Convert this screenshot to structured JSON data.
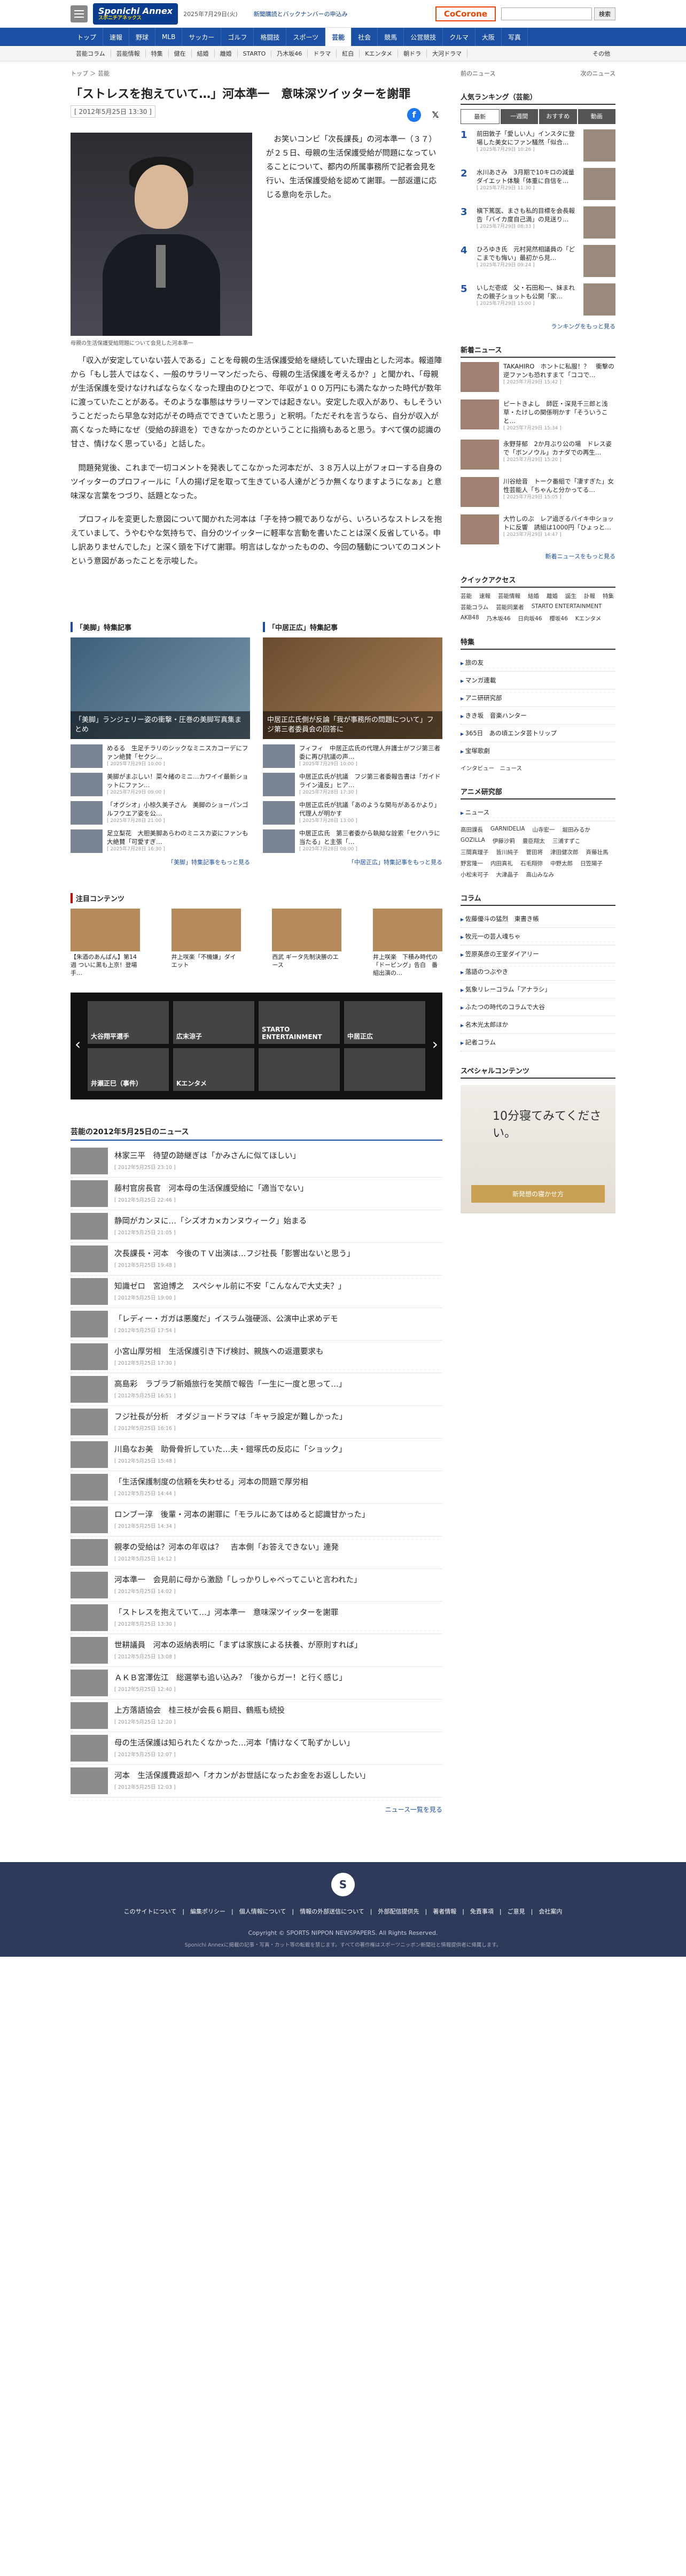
{
  "header": {
    "logo_text": "Sponichi Annex",
    "logo_sub": "スポニチアネックス",
    "date": "2025年7月29日(火)",
    "links": "新聞購読とバックナンバーの申込み",
    "cocorone": "CoCorone",
    "search_placeholder": "",
    "search_button": "検索"
  },
  "nav1": [
    "トップ",
    "速報",
    "野球",
    "MLB",
    "サッカー",
    "ゴルフ",
    "格闘技",
    "スポーツ",
    "芸能",
    "社会",
    "競馬",
    "公営競技",
    "クルマ",
    "大阪",
    "写真"
  ],
  "nav2": [
    "芸能コラム",
    "芸能情報",
    "特集",
    "健在",
    "結婚",
    "離婚",
    "STARTO",
    "乃木坂46",
    "ドラマ",
    "紅白",
    "Kエンタメ",
    "朝ドラ",
    "大河ドラマ"
  ],
  "nav2_more": "その他",
  "breadcrumb": "トップ ＞ 芸能",
  "article": {
    "title": "「ストレスを抱えていて…」河本準一　意味深ツイッターを謝罪",
    "date": "[ 2012年5月25日 13:30 ]",
    "caption": "母親の生活保護受給問題について会見した河本準一",
    "p1": "お笑いコンビ「次長課長」の河本準一（３７）が２５日、母親の生活保護受給が問題になっていることについて、都内の所属事務所で記者会見を行い、生活保護受給を認めて謝罪。一部返還に応じる意向を示した。",
    "p2": "「収入が安定していない芸人である」ことを母親の生活保護受給を継続していた理由とした河本。報道陣から「もし芸人ではなく、一般のサラリーマンだったら、母親の生活保護を考えるか？」と聞かれ、「母親が生活保護を受けなければならなくなった理由のひとつで、年収が１００万円にも満たなかった時代が数年に渡っていたことがある。そのような事態はサラリーマンでは起きない。安定した収入があり、もしそういうことだったら早急な対応がその時点でできていたと思う」と釈明。「ただそれを言うなら、自分が収入が高くなった時になぜ（受給の辞退を）できなかったのかということに指摘もあると思う。すべて僕の認識の甘さ、情けなく思っている」と話した。",
    "p3": "問題発覚後、これまで一切コメントを発表してこなかった河本だが、３８万人以上がフォローする自身のツイッターのプロフィールに「人の揚げ足を取って生きている人達がどうか無くなりますようになぁ」と意味深な言葉をつづり、話題となった。",
    "p4": "プロフィルを変更した意図について聞かれた河本は「子を持つ親でありながら、いろいろなストレスを抱えていまして、うやむやな気持ちで、自分のツイッターに軽率な言動を書いたことは深く反省している。申し訳ありませんでした」と深く頭を下げて謝罪。明言はしなかったものの、今回の騒動についてのコメントという意図があったことを示唆した。",
    "fb": "f",
    "x": "𝕏"
  },
  "special": [
    {
      "head": "「美脚」特集記事",
      "main": "「美脚」ランジェリー姿の衝撃・圧巻の美脚写真集まとめ",
      "items": [
        {
          "t": "めるる　生足チラリのシックなミニスカコーデにファン絶賛「セクシ…",
          "d": "[ 2025年7月29日 10:00 ]"
        },
        {
          "t": "美脚がまぶしい！菜々緒のミニ…カワイイ最新ショットにファン…",
          "d": "[ 2025年7月29日 09:00 ]"
        },
        {
          "t": "「オグシオ」小椋久美子さん　美脚のショーパンゴルフウエア姿を公…",
          "d": "[ 2025年7月28日 21:00 ]"
        },
        {
          "t": "足立梨花　大胆美脚あらわのミニスカ姿にファンも大絶賛「可愛すぎ…",
          "d": "[ 2025年7月28日 16:30 ]"
        }
      ],
      "more": "「美脚」特集記事をもっと見る"
    },
    {
      "head": "「中居正広」特集記事",
      "main": "中居正広氏側が反論「我が事務所の問題について」フジ第三者委員会の回答に",
      "items": [
        {
          "t": "フィフィ　中居正広氏の代理人弁護士がフジ第三者委に再び抗議の声…",
          "d": "[ 2025年7月29日 10:00 ]"
        },
        {
          "t": "中居正広氏が抗議　フジ第三者委報告書は「ガイドライン違反」ヒア…",
          "d": "[ 2025年7月28日 17:30 ]"
        },
        {
          "t": "中居正広氏が抗議「あのような関与があるかより」代理人が明かす",
          "d": "[ 2025年7月28日 13:00 ]"
        },
        {
          "t": "中居正広氏　第三者委から執拗な詮索「セクハラに当たる」と主張「…",
          "d": "[ 2025年7月28日 08:00 ]"
        }
      ],
      "more": "「中居正広」特集記事をもっと見る"
    }
  ],
  "attention": {
    "head": "注目コンテンツ",
    "cards": [
      {
        "t": "【朱酒のあんぱん】第14週 ついに黒も上京！登場手…"
      },
      {
        "t": "井上咲楽「不機嫌」ダイエット"
      },
      {
        "t": "西武 ギータ先制決勝のエース"
      },
      {
        "t": "井上咲楽　下積み時代の「ドーピング」告白　番組出演の…"
      }
    ],
    "sponsored": "Sponsored by"
  },
  "carousel": [
    "大谷翔平選手",
    "広末涼子",
    "STARTO ENTERTAINMENT",
    "中居正広",
    "井瀬正巳（事件）",
    "Kエンタメ",
    "",
    ""
  ],
  "newslist": {
    "head": "芸能の2012年5月25日のニュース",
    "items": [
      {
        "t": "林家三平　待望の跡継ぎは「かみさんに似てほしい」",
        "d": "[ 2012年5月25日 23:10 ]"
      },
      {
        "t": "藤村官房長官　河本母の生活保護受給に「適当でない」",
        "d": "[ 2012年5月25日 22:46 ]"
      },
      {
        "t": "静岡がカンヌに…「シズオカ×カンヌウィーク」始まる",
        "d": "[ 2012年5月25日 21:05 ]"
      },
      {
        "t": "次長課長・河本　今後のＴＶ出演は…フジ社長「影響出ないと思う」",
        "d": "[ 2012年5月25日 19:48 ]"
      },
      {
        "t": "知識ゼロ　宮迫博之　スペシャル前に不安「こんなんで大丈夫？」",
        "d": "[ 2012年5月25日 19:00 ]"
      },
      {
        "t": "「レディー・ガガは悪魔だ」イスラム強硬派、公演中止求めデモ",
        "d": "[ 2012年5月25日 17:54 ]"
      },
      {
        "t": "小宮山厚労相　生活保護引き下げ検討、親族への返還要求も",
        "d": "[ 2012年5月25日 17:30 ]"
      },
      {
        "t": "高島彩　ラブラブ新婚旅行を笑顔で報告「一生に一度と思って…」",
        "d": "[ 2012年5月25日 16:51 ]"
      },
      {
        "t": "フジ社長が分析　オダジョードラマは「キャラ設定が難しかった」",
        "d": "[ 2012年5月25日 16:16 ]"
      },
      {
        "t": "川島なお美　助骨骨折していた…夫・鎧塚氏の反応に「ショック」",
        "d": "[ 2012年5月25日 15:48 ]"
      },
      {
        "t": "「生活保護制度の信頼を失わせる」河本の問題で厚労相",
        "d": "[ 2012年5月25日 14:44 ]"
      },
      {
        "t": "ロンブー淳　後輩・河本の謝罪に「モラルにあてはめると認識甘かった」",
        "d": "[ 2012年5月25日 14:34 ]"
      },
      {
        "t": "親孝の受給は？河本の年収は？　吉本側「お答えできない」連発",
        "d": "[ 2012年5月25日 14:12 ]"
      },
      {
        "t": "河本準一　会見前に母から激励「しっかりしゃべってこいと言われた」",
        "d": "[ 2012年5月25日 14:02 ]"
      },
      {
        "t": "「ストレスを抱えていて…」河本準一　意味深ツイッターを謝罪",
        "d": "[ 2012年5月25日 13:30 ]"
      },
      {
        "t": "世耕議員　河本の返納表明に「まずは家族による扶養、が原則すれば」",
        "d": "[ 2012年5月25日 13:08 ]"
      },
      {
        "t": "ＡＫＢ宮澤佐江　総選挙も追い込み？「後からガー！と行く感じ」",
        "d": "[ 2012年5月25日 12:40 ]"
      },
      {
        "t": "上方落語協会　桂三枝が会長６期目、鶴瓶も続投",
        "d": "[ 2012年5月25日 12:20 ]"
      },
      {
        "t": "母の生活保護は知られたくなかった…河本「情けなくて恥ずかしい」",
        "d": "[ 2012年5月25日 12:07 ]"
      },
      {
        "t": "河本　生活保護費返却へ「オカンがお世話になったお金をお返ししたい」",
        "d": "[ 2012年5月25日 12:03 ]"
      }
    ],
    "more": "ニュース一覧を見る"
  },
  "sidebar": {
    "prev": "前のニュース",
    "next": "次のニュース",
    "rank_head": "人気ランキング（芸能）",
    "rank_tabs": [
      "最新",
      "一週間",
      "おすすめ",
      "動画"
    ],
    "rank": [
      {
        "t": "前田敦子「愛しい人」インスタに登場した美女にファン騒然「似合…",
        "d": "[ 2025年7月29日 10:26 ]"
      },
      {
        "t": "水川あさみ　3月期で10キロの減量ダイエット体験「体重に自信を…",
        "d": "[ 2025年7月29日 11:30 ]"
      },
      {
        "t": "槇下篤医、まさも私的目標を会長報告「バイカ度自己満」の見送り…",
        "d": "[ 2025年7月29日 08:33 ]"
      },
      {
        "t": "ひろゆき氏　元村晃然相議員の「どこまでも悔い」最初から見…",
        "d": "[ 2025年7月29日 09:24 ]"
      },
      {
        "t": "いしだ壱成　父・石田和一、妹まれたの親子ショットも公開「家…",
        "d": "[ 2025年7月29日 15:00 ]"
      }
    ],
    "rank_more": "ランキングをもっと見る",
    "news_head": "新着ニュース",
    "news": [
      {
        "t": "TAKAHIRO　ホントに私服！？　衝撃の逆ファンも恐れすまて「ココで…",
        "d": "[ 2025年7月29日 15:42 ]"
      },
      {
        "t": "ピートきよし　師匠・深見千三郎と浅草・たけしの関係明かす「そういうこと…",
        "d": "[ 2025年7月29日 15:34 ]"
      },
      {
        "t": "永野芽郁　2か月ぶり公の場　ドレス姿で「ボンノウル」カナダでの再生…",
        "d": "[ 2025年7月29日 15:20 ]"
      },
      {
        "t": "川谷絵音　トーク番組で「凄すぎた」女性芸能人「ちゃんと分かってる…",
        "d": "[ 2025年7月29日 15:05 ]"
      },
      {
        "t": "大竹しのぶ　レア過ぎるバイキ中ショットに反響　誘組は1000円「ひょっと…",
        "d": "[ 2025年7月29日 14:47 ]"
      }
    ],
    "news_more": "新着ニュースをもっと見る",
    "quick_head": "クイックアクセス",
    "quick": [
      "芸能",
      "速報",
      "芸能情報",
      "結婚",
      "離婚",
      "誕生",
      "訃報",
      "特集",
      "芸能コラム",
      "芸能同業者",
      "STARTO ENTERTAINMENT",
      "AKB48",
      "乃木坂46",
      "日向坂46",
      "櫻坂46",
      "Kエンタメ"
    ],
    "feature_head": "特集",
    "feature": [
      "旅の友",
      "マンガ連載",
      "アニ研研究部",
      "きき坂　音楽ハンター",
      "365日　あの頃エンタ芸トリップ",
      "宝塚歌劇"
    ],
    "feature_more": "インタビュー　ニュース",
    "anime_head": "アニメ研究部",
    "anime_sub": "ニュース",
    "anime_tags": [
      "高田課長",
      "GARNIDELIA",
      "山寺宏一",
      "堀田みるか",
      "GOZILLA",
      "伊藤沙莉",
      "豊臣翔太",
      "三浦すずこ",
      "三間真理子",
      "皆川純子",
      "菅田将",
      "津田健次郎",
      "斉藤壮馬",
      "野宮隆一",
      "内田真礼",
      "石毛翔弥",
      "中野太郎",
      "日笠陽子",
      "小松未可子",
      "大津晶子",
      "高山みなみ"
    ],
    "column_head": "コラム",
    "columns": [
      "佐藤優斗の猛烈　東書き帳",
      "牧元一の芸人魂ちゃ",
      "笠原英彦の王室ダイアリー",
      "落語のつぶやき",
      "気象リレーコラム「アナラシ」",
      "ふたつの時代のコラムで大谷",
      "名木光太郎ほか",
      "記者コラム"
    ],
    "special_head": "スペシャルコンテンツ",
    "ad_text": "10分寝てみてください。",
    "ad_button": "新発想の寝かせ方"
  },
  "footer": {
    "logo": "S",
    "links": "このサイトについて　|　編集ポリシー　|　個人情報について　|　情報の外部送信について　|　外部配信提供先　|　著者情報　|　免責事項　|　ご意見　|　会社案内",
    "copy": "Copyright © SPORTS NIPPON NEWSPAPERS. All Rights Reserved.",
    "note": "Sponichi Annexに掲載の記事・写真・カット等の転載を禁じます。すべての著作権はスポーツニッポン新聞社と情報提供者に帰属します。"
  }
}
